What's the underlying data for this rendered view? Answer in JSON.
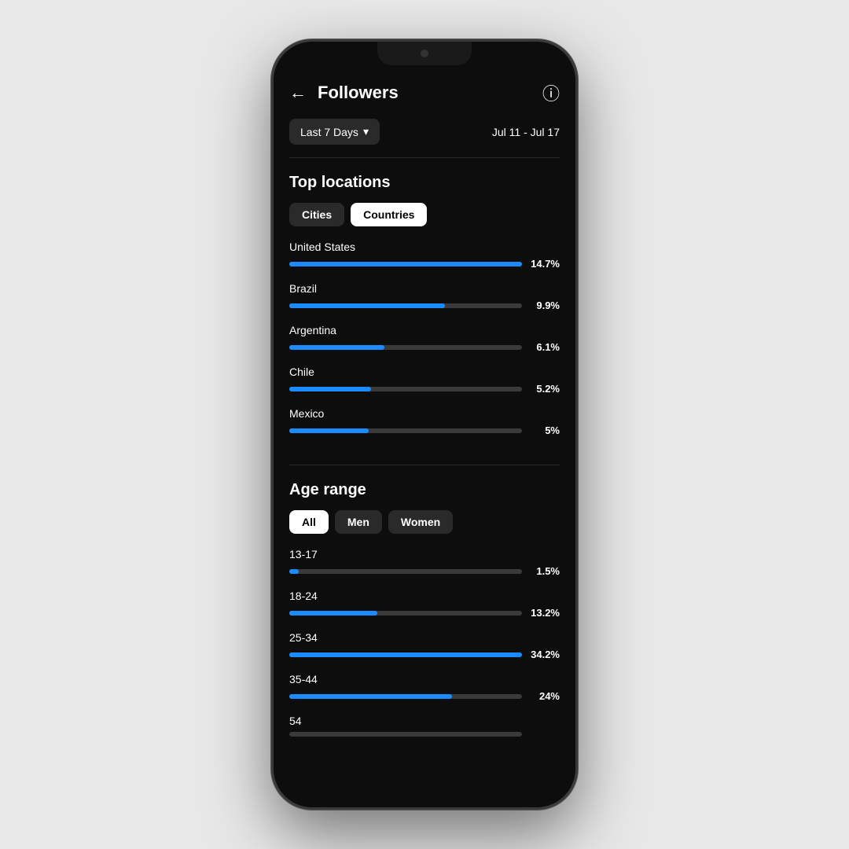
{
  "header": {
    "back_label": "←",
    "title": "Followers",
    "info_icon": "ⓘ"
  },
  "filter": {
    "date_btn_label": "Last 7 Days",
    "chevron": "▾",
    "date_range": "Jul 11 - Jul 17"
  },
  "top_locations": {
    "section_title": "Top locations",
    "tabs": [
      {
        "label": "Cities",
        "active": false
      },
      {
        "label": "Countries",
        "active": true
      }
    ],
    "countries": [
      {
        "name": "United States",
        "value": "14.7%",
        "pct": 14.7
      },
      {
        "name": "Brazil",
        "value": "9.9%",
        "pct": 9.9
      },
      {
        "name": "Argentina",
        "value": "6.1%",
        "pct": 6.1
      },
      {
        "name": "Chile",
        "value": "5.2%",
        "pct": 5.2
      },
      {
        "name": "Mexico",
        "value": "5%",
        "pct": 5.0
      }
    ]
  },
  "age_range": {
    "section_title": "Age range",
    "tabs": [
      {
        "label": "All",
        "active": true
      },
      {
        "label": "Men",
        "active": false
      },
      {
        "label": "Women",
        "active": false
      }
    ],
    "ages": [
      {
        "name": "13-17",
        "value": "1.5%",
        "pct": 1.5
      },
      {
        "name": "18-24",
        "value": "13.2%",
        "pct": 13.2
      },
      {
        "name": "25-34",
        "value": "34.2%",
        "pct": 34.2
      },
      {
        "name": "35-44",
        "value": "24%",
        "pct": 24.0
      },
      {
        "name": "54",
        "value": "",
        "pct": 0
      }
    ]
  },
  "colors": {
    "bar_fill": "#1a8cff",
    "bar_track": "#3a3a3a",
    "active_tab_bg": "#ffffff",
    "active_tab_text": "#000000",
    "inactive_tab_bg": "#2a2a2a",
    "inactive_tab_text": "#ffffff"
  }
}
